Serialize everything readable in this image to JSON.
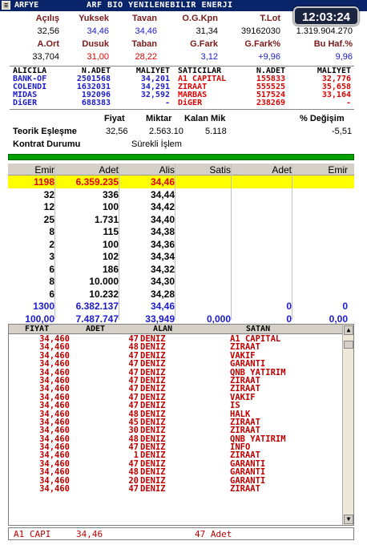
{
  "title": {
    "code": "ARFYE",
    "name": "ARF BIO YENILENEBILIR ENERJI",
    "sys_icon": "window-menu-icon"
  },
  "clock": "12:03:24",
  "summary": {
    "row1_headers": [
      "Açılış",
      "Yuksek",
      "Tavan",
      "O.G.Kpn",
      "T.Lot",
      "Cirosu"
    ],
    "row1_values": [
      "32,56",
      "34,46",
      "34,46",
      "31,34",
      "39162030",
      "1.319.904.270"
    ],
    "row2_headers": [
      "A.Ort",
      "Dusuk",
      "Taban",
      "G.Fark",
      "G.Fark%",
      "Bu Haf.%"
    ],
    "row2_values": [
      "33,704",
      "31,00",
      "28,22",
      "3,12",
      "+9,96",
      "9,96"
    ]
  },
  "brokers": {
    "headers": [
      "ALICILA",
      "N.ADET",
      "MALIYET",
      "SATICILAR",
      "N.ADET",
      "MALIYET"
    ],
    "rows": [
      [
        "BANK-OF",
        "2501568",
        "34,201",
        "A1 CAPITAL",
        "155833",
        "32,776"
      ],
      [
        "COLENDI",
        "1632031",
        "34,291",
        "ZIRAAT",
        "555525",
        "35,658"
      ],
      [
        "MIDAS",
        "192096",
        "32,592",
        "MARBAS",
        "517524",
        "33,164"
      ],
      [
        "DiGER",
        "688383",
        "-",
        "DiGER",
        "238269",
        "-"
      ]
    ]
  },
  "theoretical": {
    "headers": [
      "Fiyat",
      "Miktar",
      "Kalan Mik",
      "% Değişim"
    ],
    "label": "Teorik Eşleşme",
    "price": "32,56",
    "qty": "2.563.10",
    "remaining": "5.118",
    "change": "-5,51",
    "status_label": "Kontrat Durumu",
    "status_value": "Sürekli İşlem"
  },
  "depth": {
    "headers": [
      "Emir",
      "Adet",
      "Alis",
      "Satis",
      "Adet",
      "Emir"
    ],
    "rows": [
      [
        "1198",
        "6.359.235",
        "34,46"
      ],
      [
        "32",
        "336",
        "34,44"
      ],
      [
        "12",
        "100",
        "34,42"
      ],
      [
        "25",
        "1.731",
        "34,40"
      ],
      [
        "8",
        "115",
        "34,38"
      ],
      [
        "2",
        "100",
        "34,36"
      ],
      [
        "3",
        "102",
        "34,34"
      ],
      [
        "6",
        "186",
        "34,32"
      ],
      [
        "8",
        "10.000",
        "34,30"
      ],
      [
        "6",
        "10.232",
        "34,28"
      ]
    ],
    "total1": [
      "1300",
      "6.382.137",
      "34,46",
      "",
      "0",
      "0"
    ],
    "total2": [
      "100,00",
      "7.487.747",
      "33,949",
      "0,000",
      "0",
      "0,00"
    ]
  },
  "trades": {
    "headers": [
      "FIYAT",
      "ADET",
      "ALAN",
      "SATAN"
    ],
    "rows": [
      [
        "34,460",
        "47",
        "DENIZ",
        "A1 CAPITAL"
      ],
      [
        "34,460",
        "48",
        "DENIZ",
        "ZIRAAT"
      ],
      [
        "34,460",
        "47",
        "DENIZ",
        "VAKIF"
      ],
      [
        "34,460",
        "47",
        "DENIZ",
        "GARANTI"
      ],
      [
        "34,460",
        "47",
        "DENIZ",
        "QNB YATIRIM"
      ],
      [
        "34,460",
        "47",
        "DENIZ",
        "ZIRAAT"
      ],
      [
        "34,460",
        "47",
        "DENIZ",
        "ZIRAAT"
      ],
      [
        "34,460",
        "47",
        "DENIZ",
        "VAKIF"
      ],
      [
        "34,460",
        "47",
        "DENIZ",
        "IS"
      ],
      [
        "34,460",
        "48",
        "DENIZ",
        "HALK"
      ],
      [
        "34,460",
        "45",
        "DENIZ",
        "ZIRAAT"
      ],
      [
        "34,460",
        "30",
        "DENIZ",
        "ZIRAAT"
      ],
      [
        "34,460",
        "48",
        "DENIZ",
        "QNB YATIRIM"
      ],
      [
        "34,460",
        "47",
        "DENIZ",
        "INFO"
      ],
      [
        "34,460",
        "1",
        "DENIZ",
        "ZIRAAT"
      ],
      [
        "34,460",
        "47",
        "DENIZ",
        "GARANTI"
      ],
      [
        "34,460",
        "48",
        "DENIZ",
        "GARANTI"
      ],
      [
        "34,460",
        "20",
        "DENIZ",
        "GARANTI"
      ],
      [
        "34,460",
        "47",
        "DENIZ",
        "ZIRAAT"
      ]
    ]
  },
  "statusline": {
    "broker": "A1 CAPI",
    "price": "34,46",
    "qty": "47 Adet"
  },
  "colors": {
    "title_bg": "#0a246a",
    "highlight": "#ffff00",
    "trade_text": "#c00000",
    "total_text": "#1a1acc",
    "green_bar": "#00a000"
  }
}
